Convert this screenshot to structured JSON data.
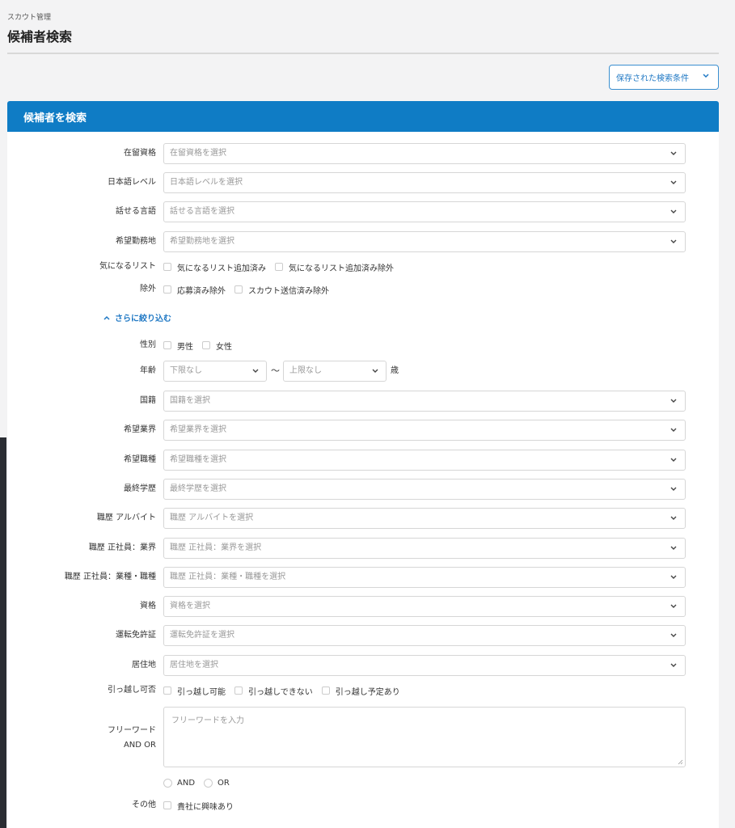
{
  "header": {
    "breadcrumb": "スカウト管理",
    "title": "候補者検索"
  },
  "saved_search": {
    "label": "保存された検索条件"
  },
  "panel": {
    "title": "候補者を検索"
  },
  "fields": {
    "residence_status": {
      "label": "在留資格",
      "placeholder": "在留資格を選択"
    },
    "japanese_level": {
      "label": "日本語レベル",
      "placeholder": "日本語レベルを選択"
    },
    "languages": {
      "label": "話せる言語",
      "placeholder": "話せる言語を選択"
    },
    "work_location": {
      "label": "希望勤務地",
      "placeholder": "希望勤務地を選択"
    },
    "watchlist": {
      "label": "気になるリスト",
      "options": [
        "気になるリスト追加済み",
        "気になるリスト追加済み除外"
      ]
    },
    "exclude": {
      "label": "除外",
      "options": [
        "応募済み除外",
        "スカウト送信済み除外"
      ]
    },
    "more_toggle": "さらに絞り込む",
    "gender": {
      "label": "性別",
      "options": [
        "男性",
        "女性"
      ]
    },
    "age": {
      "label": "年齢",
      "min_placeholder": "下限なし",
      "max_placeholder": "上限なし",
      "separator": "〜",
      "unit": "歳"
    },
    "nationality": {
      "label": "国籍",
      "placeholder": "国籍を選択"
    },
    "industry": {
      "label": "希望業界",
      "placeholder": "希望業界を選択"
    },
    "job_type": {
      "label": "希望職種",
      "placeholder": "希望職種を選択"
    },
    "education": {
      "label": "最終学歴",
      "placeholder": "最終学歴を選択"
    },
    "career_parttime": {
      "label": "職歴 アルバイト",
      "placeholder": "職歴 アルバイトを選択"
    },
    "career_fulltime_industry": {
      "label": "職歴 正社員：業界",
      "placeholder": "職歴 正社員：業界を選択"
    },
    "career_fulltime_job": {
      "label": "職歴 正社員：業種・職種",
      "placeholder": "職歴 正社員：業種・職種を選択"
    },
    "qualification": {
      "label": "資格",
      "placeholder": "資格を選択"
    },
    "license": {
      "label": "運転免許証",
      "placeholder": "運転免許証を選択"
    },
    "residence": {
      "label": "居住地",
      "placeholder": "居住地を選択"
    },
    "relocation": {
      "label": "引っ越し可否",
      "options": [
        "引っ越し可能",
        "引っ越しできない",
        "引っ越し予定あり"
      ]
    },
    "freeword": {
      "label_line1": "フリーワード",
      "label_line2": "AND OR",
      "placeholder": "フリーワードを入力",
      "modes": [
        "AND",
        "OR"
      ]
    },
    "other": {
      "label": "その他",
      "options": [
        "貴社に興味あり"
      ]
    }
  },
  "icons": {
    "chevron": "chevron-down-icon",
    "chevron_up": "chevron-up-icon"
  },
  "colors": {
    "accent": "#0f7cc5",
    "link": "#1f78c4"
  }
}
